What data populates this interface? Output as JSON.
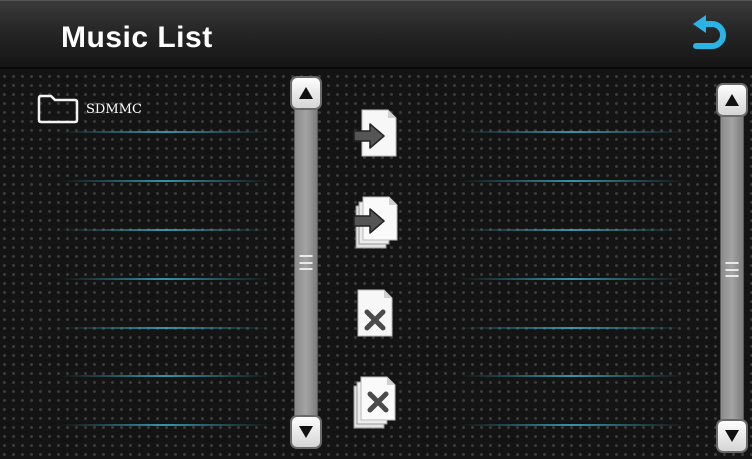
{
  "header": {
    "title": "Music List"
  },
  "source_folder": {
    "label": "SDMMC"
  },
  "actions": [
    {
      "name": "copy-file",
      "icon": "file-arrow-icon"
    },
    {
      "name": "copy-all-files",
      "icon": "files-arrow-icon"
    },
    {
      "name": "delete-file",
      "icon": "file-x-icon"
    },
    {
      "name": "delete-all-files",
      "icon": "files-x-icon"
    }
  ],
  "colors": {
    "accent": "#2ab4e6",
    "slot_line": "#3aaabe",
    "background": "#141414"
  }
}
